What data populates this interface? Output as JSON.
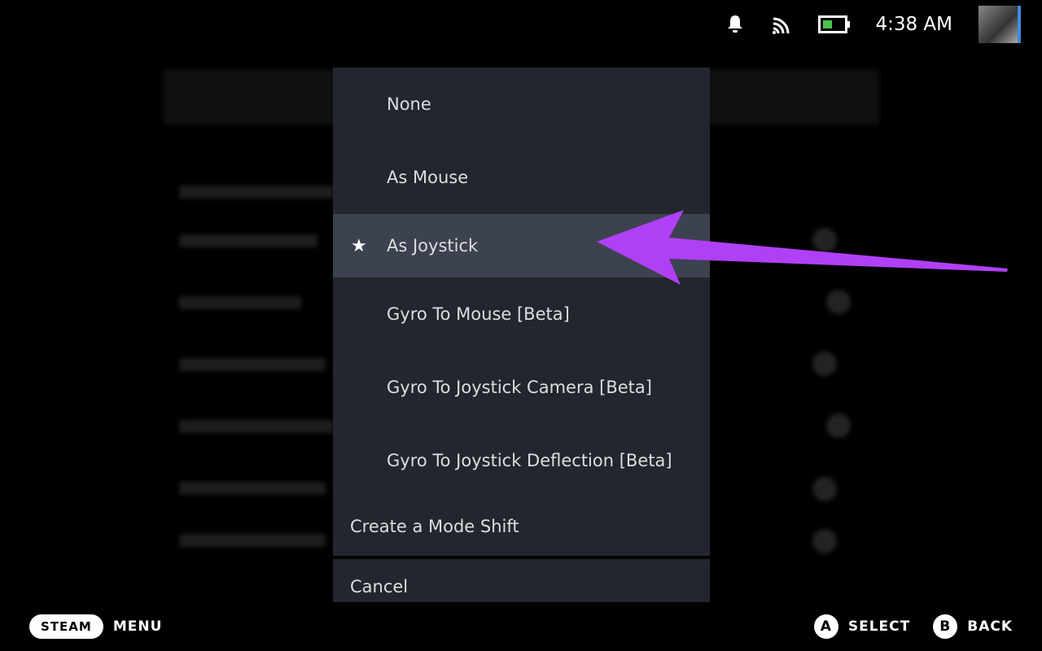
{
  "status_bar": {
    "time": "4:38 AM",
    "icons": [
      "bell-icon",
      "wifi-icon",
      "battery-icon"
    ],
    "battery_color": "#4cc34a"
  },
  "menu": {
    "items": [
      {
        "label": "None",
        "selected": false
      },
      {
        "label": "As Mouse",
        "selected": false
      },
      {
        "label": "As Joystick",
        "selected": true
      },
      {
        "label": "Gyro To Mouse [Beta]",
        "selected": false
      },
      {
        "label": "Gyro To Joystick Camera [Beta]",
        "selected": false
      },
      {
        "label": "Gyro To Joystick Deflection [Beta]",
        "selected": false
      }
    ],
    "mode_shift": "Create a Mode Shift",
    "cancel": "Cancel"
  },
  "annotation": {
    "arrow_color": "#b040f5"
  },
  "footer": {
    "steam": "STEAM",
    "menu": "MENU",
    "a": "A",
    "select": "SELECT",
    "b": "B",
    "back": "BACK"
  }
}
